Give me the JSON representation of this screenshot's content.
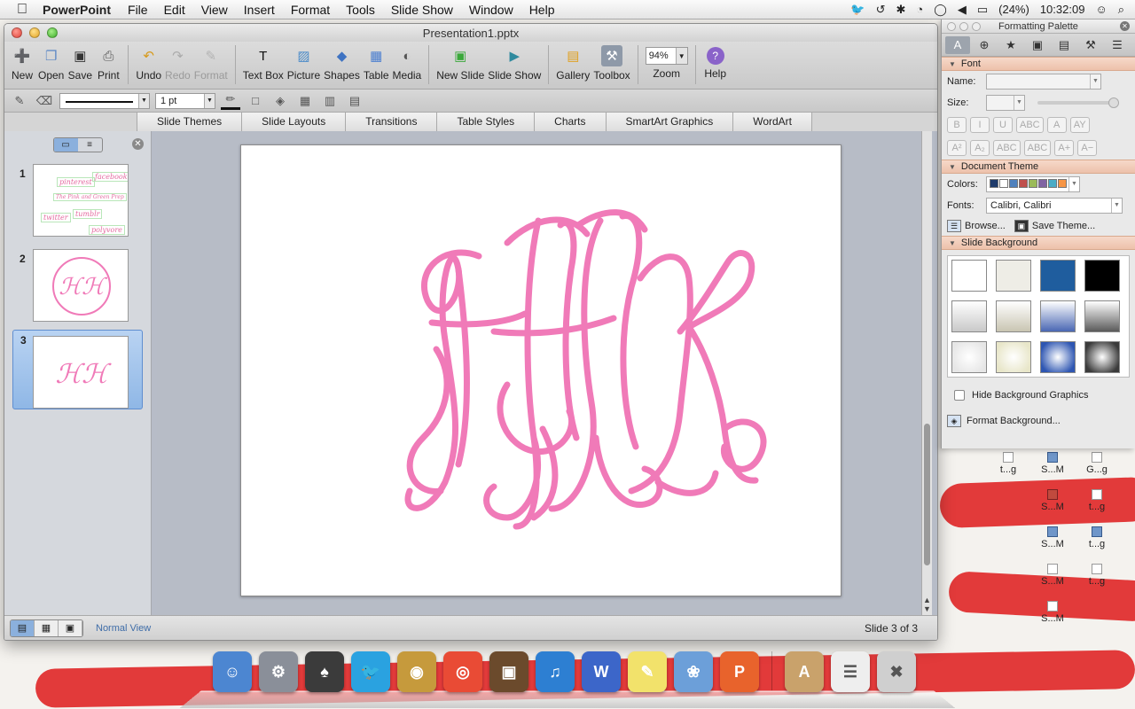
{
  "menubar": {
    "app_name": "PowerPoint",
    "menus": [
      "File",
      "Edit",
      "View",
      "Insert",
      "Format",
      "Tools",
      "Slide Show",
      "Window",
      "Help"
    ],
    "battery": "(24%)",
    "clock": "10:32:09"
  },
  "window": {
    "title": "Presentation1.pptx",
    "toolbar": [
      {
        "label": "New",
        "icon": "new-icon",
        "enabled": true
      },
      {
        "label": "Open",
        "icon": "open-icon",
        "enabled": true
      },
      {
        "label": "Save",
        "icon": "save-icon",
        "enabled": true
      },
      {
        "label": "Print",
        "icon": "print-icon",
        "enabled": true
      },
      {
        "label": "Undo",
        "icon": "undo-icon",
        "enabled": true
      },
      {
        "label": "Redo",
        "icon": "redo-icon",
        "enabled": false
      },
      {
        "label": "Format",
        "icon": "format-brush-icon",
        "enabled": false
      },
      {
        "label": "Text Box",
        "icon": "text-box-icon",
        "enabled": true
      },
      {
        "label": "Picture",
        "icon": "picture-icon",
        "enabled": true
      },
      {
        "label": "Shapes",
        "icon": "shapes-icon",
        "enabled": true
      },
      {
        "label": "Table",
        "icon": "table-icon",
        "enabled": true
      },
      {
        "label": "Media",
        "icon": "media-icon",
        "enabled": true
      },
      {
        "label": "New Slide",
        "icon": "new-slide-icon",
        "enabled": true
      },
      {
        "label": "Slide Show",
        "icon": "slide-show-icon",
        "enabled": true
      },
      {
        "label": "Gallery",
        "icon": "gallery-icon",
        "enabled": true
      },
      {
        "label": "Toolbox",
        "icon": "toolbox-icon",
        "enabled": true
      }
    ],
    "zoom": {
      "value": "94%",
      "label": "Zoom"
    },
    "help_label": "Help",
    "line_weight": "1 pt",
    "ribbon_tabs": [
      "Slide Themes",
      "Slide Layouts",
      "Transitions",
      "Table Styles",
      "Charts",
      "SmartArt Graphics",
      "WordArt"
    ],
    "slides": [
      {
        "number": "1",
        "tags": [
          "pinterest",
          "facebook",
          "The Pink and Green Prep",
          "twitter",
          "tumblr",
          "polyvore"
        ]
      },
      {
        "number": "2"
      },
      {
        "number": "3",
        "selected": true
      }
    ],
    "monogram_color": "#f07ab8",
    "status": {
      "view": "Normal View",
      "count": "Slide 3 of 3"
    }
  },
  "palette": {
    "title": "Formatting Palette",
    "font": {
      "section": "Font",
      "name_label": "Name:",
      "size_label": "Size:",
      "style_buttons": [
        "B",
        "I",
        "U",
        "ABC",
        "A",
        "AY"
      ],
      "script_buttons": [
        "A²",
        "A₂",
        "ABC",
        "ABC",
        "A+",
        "A−"
      ]
    },
    "theme": {
      "section": "Document Theme",
      "colors_label": "Colors:",
      "theme_colors": [
        "#1f3b6b",
        "#ffffff",
        "#4f81bd",
        "#c0504d",
        "#9bbb59",
        "#8064a2",
        "#4bacc6",
        "#f79646"
      ],
      "fonts_label": "Fonts:",
      "fonts_value": "Calibri, Calibri",
      "browse_label": "Browse...",
      "save_label": "Save Theme..."
    },
    "background": {
      "section": "Slide Background",
      "swatches": [
        "#ffffff",
        "#eeede6",
        "#1f5d9e",
        "#000000",
        "#c9c9c9",
        "#c9c5b2",
        "#4a67b3",
        "#5a5a5a",
        "#e6e6e6",
        "#e8e6c9",
        "#2e56b2",
        "#3b3b3b"
      ],
      "hide_graphics": "Hide Background Graphics",
      "format_label": "Format Background..."
    }
  },
  "desktop_icons": [
    {
      "label": "t...g"
    },
    {
      "label": "S...M"
    },
    {
      "label": "G...g"
    },
    {
      "label": "S...M"
    },
    {
      "label": "S...M"
    },
    {
      "label": "t...g"
    },
    {
      "label": "S...M"
    },
    {
      "label": "t...g"
    },
    {
      "label": "S...M"
    },
    {
      "label": "t...g"
    }
  ],
  "dock": [
    "finder-icon",
    "system-preferences-icon",
    "skull-app-icon",
    "twitter-icon",
    "preview-icon",
    "chrome-icon",
    "image-capture-icon",
    "itunes-icon",
    "word-icon",
    "stickies-icon",
    "iphoto-icon",
    "powerpoint-icon",
    "applications-folder-icon",
    "documents-folder-icon",
    "trash-icon"
  ]
}
